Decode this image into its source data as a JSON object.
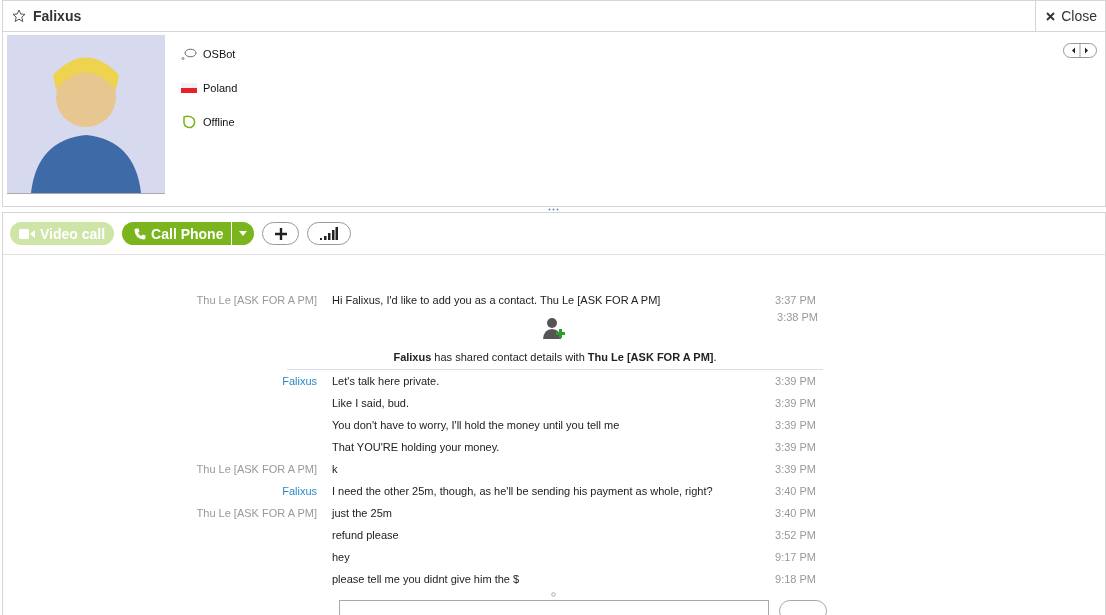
{
  "header": {
    "title": "Falixus",
    "close_label": "Close"
  },
  "profile": {
    "details": [
      {
        "kind": "mood",
        "text": "OSBot"
      },
      {
        "kind": "country",
        "text": "Poland"
      },
      {
        "kind": "status",
        "text": "Offline"
      }
    ]
  },
  "toolbar": {
    "video_call": {
      "label": "Video call",
      "disabled": true
    },
    "call_phone": {
      "label": "Call Phone"
    }
  },
  "messages": [
    {
      "kind": "message",
      "sender": "Thu Le [ASK FOR A PM]",
      "color": "#999999",
      "text": "Hi Falixus, I'd like to add you as a contact. Thu Le [ASK FOR A PM]",
      "time": "3:37 PM"
    },
    {
      "kind": "contact_share",
      "text": "**Falixus** has shared contact details with **Thu Le [ASK FOR A PM]**.",
      "time": "3:38 PM"
    },
    {
      "kind": "message",
      "sender": "Falixus",
      "color": "#2b87c9",
      "text": "Let's talk here private.",
      "time": "3:39 PM"
    },
    {
      "kind": "message",
      "text": "Like I said, bud.",
      "time": "3:39 PM"
    },
    {
      "kind": "message",
      "text": "You don't have to worry, I'll hold the money until you tell me",
      "time": "3:39 PM"
    },
    {
      "kind": "message",
      "text": "That YOU'RE holding your money.",
      "time": "3:39 PM"
    },
    {
      "kind": "message",
      "sender": "Thu Le [ASK FOR A PM]",
      "color": "#999999",
      "text": "k",
      "time": "3:39 PM"
    },
    {
      "kind": "message",
      "sender": "Falixus",
      "color": "#2b87c9",
      "text": "I need the other 25m, though, as he'll be sending his payment as whole, right?",
      "time": "3:40 PM"
    },
    {
      "kind": "message",
      "sender": "Thu Le [ASK FOR A PM]",
      "color": "#999999",
      "text": "just the 25m",
      "time": "3:40 PM"
    },
    {
      "kind": "message",
      "text": "refund please",
      "time": "3:52 PM"
    },
    {
      "kind": "message",
      "text": "hey",
      "time": "9:17 PM"
    },
    {
      "kind": "message",
      "text": "please tell me you didnt give him the $",
      "time": "9:18 PM"
    }
  ]
}
